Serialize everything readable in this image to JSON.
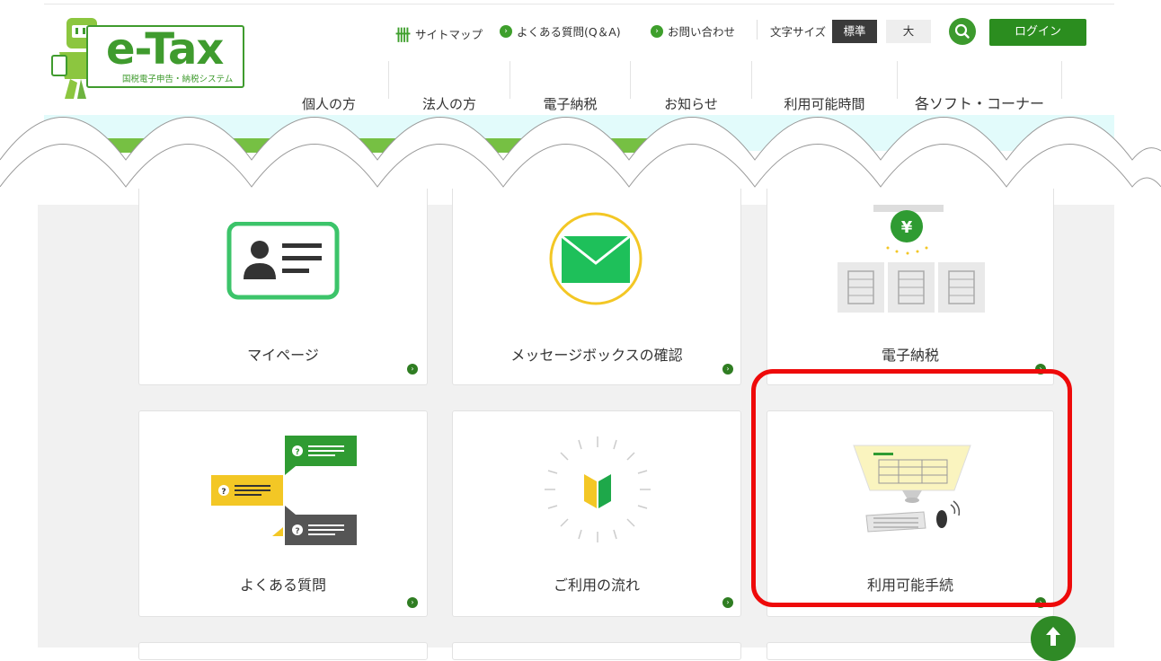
{
  "logo": {
    "text": "e-Tax",
    "subtitle": "国税電子申告・納税システム"
  },
  "utility": {
    "sitemap": "サイトマップ",
    "faq": "よくある質問(Q＆A)",
    "contact": "お問い合わせ",
    "font_size_label": "文字サイズ",
    "font_size_standard": "標準",
    "font_size_large": "大",
    "login": "ログイン"
  },
  "nav": {
    "items": [
      {
        "label": "個人の方"
      },
      {
        "label": "法人の方"
      },
      {
        "label": "電子納税"
      },
      {
        "label": "お知らせ"
      },
      {
        "label": "利用可能時間"
      },
      {
        "label": "各ソフト・コーナー"
      }
    ]
  },
  "cards": {
    "mypage": "マイページ",
    "messagebox": "メッセージボックスの確認",
    "epayment": "電子納税",
    "faq": "よくある質問",
    "flow": "ご利用の流れ",
    "procedures": "利用可能手続"
  },
  "colors": {
    "brand_green": "#3f9b2e",
    "highlight_red": "#ee0a0a",
    "mint_band": "#e2fbfb"
  }
}
